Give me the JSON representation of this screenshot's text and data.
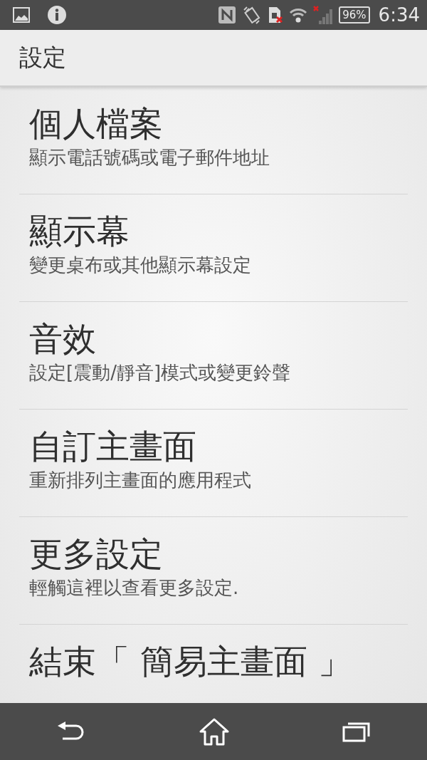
{
  "status_bar": {
    "battery": "96%",
    "time": "6:34"
  },
  "app_bar": {
    "title": "設定"
  },
  "items": [
    {
      "title": "個人檔案",
      "subtitle": "顯示電話號碼或電子郵件地址"
    },
    {
      "title": "顯示幕",
      "subtitle": "變更桌布或其他顯示幕設定"
    },
    {
      "title": "音效",
      "subtitle": "設定[震動/靜音]模式或變更鈴聲"
    },
    {
      "title": "自訂主畫面",
      "subtitle": "重新排列主畫面的應用程式"
    },
    {
      "title": "更多設定",
      "subtitle": "輕觸這裡以查看更多設定."
    },
    {
      "title": "結束「 簡易主畫面 」"
    }
  ]
}
